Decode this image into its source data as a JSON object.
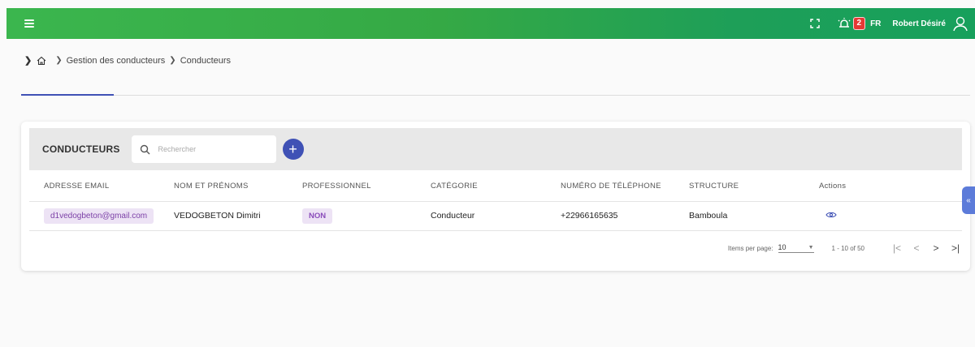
{
  "topbar": {
    "menu_icon": "hamburger-icon",
    "fullscreen_icon": "fullscreen-icon",
    "alarm_icon": "alarm-icon",
    "notification_count": "2",
    "language": "FR",
    "user_name": "Robert Désiré",
    "user_icon": "user-icon",
    "colors": {
      "start": "#3bb64e",
      "end": "#17a05c"
    }
  },
  "breadcrumb": {
    "home_icon": "home-icon",
    "items": [
      "Gestion des conducteurs",
      "Conducteurs"
    ]
  },
  "card": {
    "title": "CONDUCTEURS",
    "search": {
      "placeholder": "Rechercher",
      "value": ""
    },
    "add_label": "+",
    "columns": [
      "ADRESSE EMAIL",
      "NOM ET PRÉNOMS",
      "PROFESSIONNEL",
      "CATÉGORIE",
      "NUMÉRO DE TÉLÉPHONE",
      "STRUCTURE",
      "Actions"
    ],
    "rows": [
      {
        "email": "d1vedogbeton@gmail.com",
        "name": "VEDOGBETON Dimitri",
        "professionnel": "NON",
        "categorie": "Conducteur",
        "telephone": "+22966165635",
        "structure": "Bamboula",
        "action_icon": "eye-icon"
      }
    ],
    "paginator": {
      "items_per_page_label": "Items per page:",
      "items_per_page": "10",
      "range": "1 - 10 of 50",
      "first": "|<",
      "prev": "<",
      "next": ">",
      "last": ">|"
    }
  },
  "accent_color": "#3f51b5",
  "side_tab_icon": "collapse-icon"
}
